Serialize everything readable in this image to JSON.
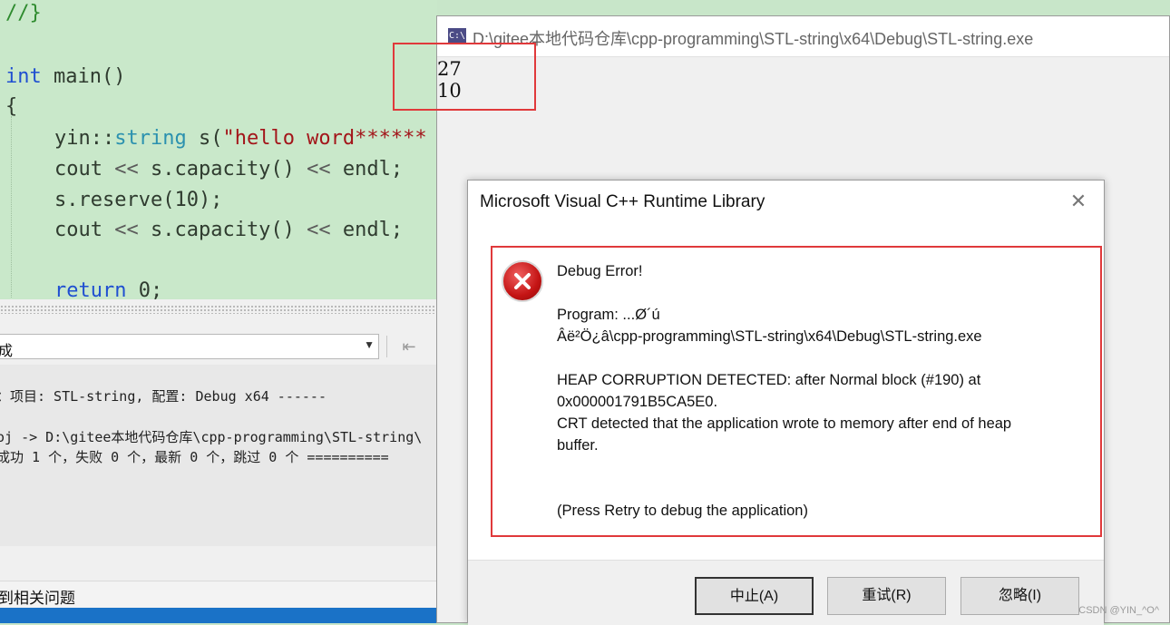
{
  "editor": {
    "line_comment": "//}",
    "main_kw": "int",
    "main_sig": " main()",
    "brace_open": "{",
    "l1_ns": "yin::",
    "l1_type": "string",
    "l1_var": " s(",
    "l1_str": "\"hello word******",
    "l2_a": "cout ",
    "l2_op1": "<<",
    "l2_b": " s.capacity() ",
    "l2_op2": "<<",
    "l2_c": " endl;",
    "l3": "s.reserve(10);",
    "l4_a": "cout ",
    "l4_op1": "<<",
    "l4_b": " s.capacity() ",
    "l4_op2": "<<",
    "l4_c": " endl;",
    "l5_kw": "return",
    "l5_rest": " 0;"
  },
  "output_panel": {
    "source_value": "成",
    "lines": [
      "：项目: STL-string, 配置: Debug x64 ------",
      "oj -> D:\\gitee本地代码仓库\\cpp-programming\\STL-string\\",
      "成功 1 个，失败 0 个，最新 0 个，跳过 0 个 =========="
    ],
    "status_text": "到相关问题"
  },
  "console": {
    "icon_text": "C:\\",
    "title": "D:\\gitee本地代码仓库\\cpp-programming\\STL-string\\x64\\Debug\\STL-string.exe",
    "output": [
      "27",
      "10"
    ]
  },
  "dialog": {
    "title": "Microsoft Visual C++ Runtime Library",
    "heading": "Debug Error!",
    "program_line1": "Program: ...Ø´ú",
    "program_line2": "Âë²Ö¿â\\cpp-programming\\STL-string\\x64\\Debug\\STL-string.exe",
    "heap_line1": "HEAP CORRUPTION DETECTED: after Normal block (#190) at",
    "heap_line2": "0x000001791B5CA5E0.",
    "crt_line1": "CRT detected that the application wrote to memory after end of heap",
    "crt_line2": "buffer.",
    "press_retry": "(Press Retry to debug the application)",
    "buttons": {
      "abort": "中止(A)",
      "retry": "重试(R)",
      "ignore": "忽略(I)"
    }
  },
  "watermark": "CSDN @YIN_^O^",
  "colors": {
    "editor_bg": "#c9e8ca",
    "highlight_red": "#e0393b",
    "keyword_blue": "#1f4fd1",
    "taskbar_blue": "#1a72c7"
  }
}
